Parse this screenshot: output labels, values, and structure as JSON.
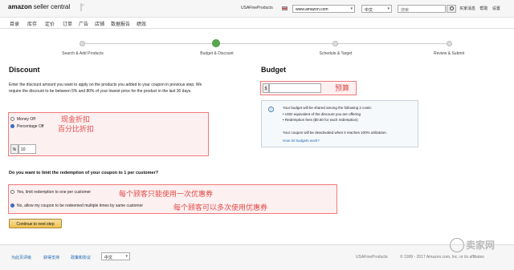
{
  "topbar": {
    "logo_main": "amazon",
    "logo_sub": "seller central",
    "store_name": "USAFineProducts",
    "marketplace": "www.amazon.com",
    "language": "中文",
    "search_placeholder": "搜索",
    "links": [
      "买家消息",
      "帮助",
      "设置"
    ]
  },
  "nav": [
    "目录",
    "库存",
    "定价",
    "订单",
    "广告",
    "店铺",
    "数据报告",
    "绩效"
  ],
  "steps": [
    {
      "label": "Search & Add Products",
      "active": false
    },
    {
      "label": "Budget & Discount",
      "active": true
    },
    {
      "label": "Schedule & Target",
      "active": false
    },
    {
      "label": "Review & Submit",
      "active": false
    }
  ],
  "discount": {
    "title": "Discount",
    "description": "Enter the discount amount you want to apply on the products you added to your coupon in previous step. We require the discount to be between 5% and 80% of your lowest price for the product in the last 30 days.",
    "option_money": "Money Off",
    "option_percentage": "Percentage Off",
    "percent_symbol": "%",
    "percent_value": "10",
    "annotation_money": "现金折扣",
    "annotation_percentage": "百分比折扣"
  },
  "budget": {
    "title": "Budget",
    "currency_symbol": "$",
    "annotation": "预算",
    "info_line1": "Your budget will be shared among the following 2 costs:",
    "info_bullet1": "• USD equivalent of the discount you are offering",
    "info_bullet2": "• Redemption fees ($0.60 for each redemption)",
    "info_line2": "Your coupon will be deactivated when it reaches 100% utilization.",
    "info_link": "How do budgets work?"
  },
  "limit": {
    "question": "Do you want to limit the redemption of your coupon to 1 per customer?",
    "option_yes": "Yes, limit redemption to one per customer",
    "option_no": "No, allow my coupon to be redeemed multiple times by same customer",
    "annotation_yes": "每个顾客只能使用一次优惠券",
    "annotation_no": "每个顾客可以多次使用优惠券"
  },
  "continue_label": "Continue to next step",
  "footer": {
    "links": [
      "为此页评级",
      "获得支持",
      "政策和协议"
    ],
    "language": "中文",
    "store": "USAFineProducts",
    "copyright": "© 1999 - 2017 Amazon.com, Inc. or its affiliates"
  },
  "watermark": "卖家网",
  "colors": {
    "accent_red": "#e24a4a",
    "step_active": "#57a74e",
    "button_yellow": "#f0c14b"
  }
}
